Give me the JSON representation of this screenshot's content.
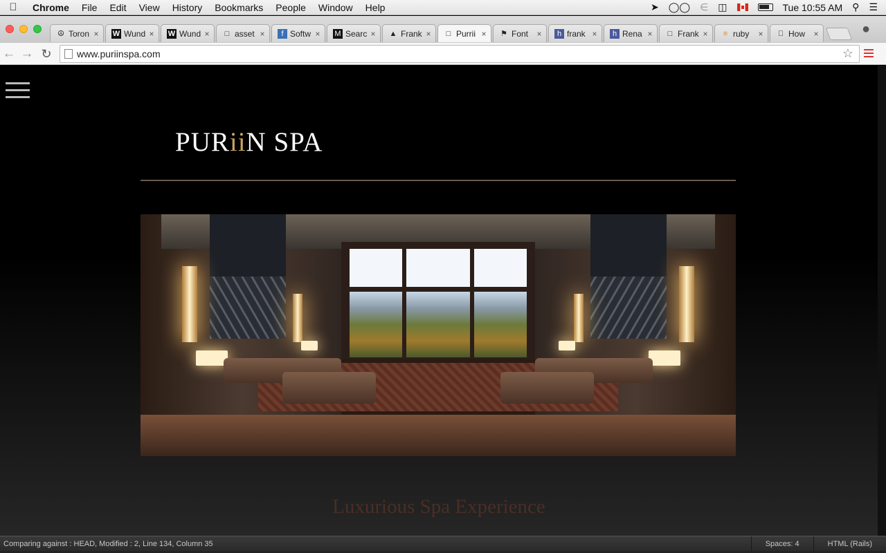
{
  "menubar": {
    "app": "Chrome",
    "items": [
      "File",
      "Edit",
      "View",
      "History",
      "Bookmarks",
      "People",
      "Window",
      "Help"
    ],
    "clock": "Tue 10:55 AM"
  },
  "tabs": [
    {
      "title": "Toron",
      "icon": "peace-icon"
    },
    {
      "title": "Wund",
      "icon": "w-icon"
    },
    {
      "title": "Wund",
      "icon": "w-icon"
    },
    {
      "title": "asset",
      "icon": "page-icon"
    },
    {
      "title": "Softw",
      "icon": "f-icon"
    },
    {
      "title": "Searc",
      "icon": "m-icon"
    },
    {
      "title": "Frank",
      "icon": "cap-icon"
    },
    {
      "title": "Purrii",
      "icon": "page-icon",
      "active": true
    },
    {
      "title": "Font",
      "icon": "flag-icon"
    },
    {
      "title": "frank",
      "icon": "h-icon"
    },
    {
      "title": "Rena",
      "icon": "h-icon"
    },
    {
      "title": "Frank",
      "icon": "page-icon"
    },
    {
      "title": "ruby",
      "icon": "stack-icon"
    },
    {
      "title": "How",
      "icon": "apple-icon"
    }
  ],
  "toolbar": {
    "url": "www.puriinspa.com"
  },
  "page": {
    "logo_left": "PUR",
    "logo_gold": "ii",
    "logo_right": "N SPA",
    "tagline": "Luxurious Spa Experience"
  },
  "statusbar": {
    "left": "Comparing against : HEAD, Modified : 2, Line 134, Column 35",
    "spaces": "Spaces: 4",
    "syntax": "HTML (Rails)"
  },
  "colors": {
    "gold": "#c9a45b",
    "tagline": "#4a2e26",
    "rule": "#6a5a4a"
  }
}
